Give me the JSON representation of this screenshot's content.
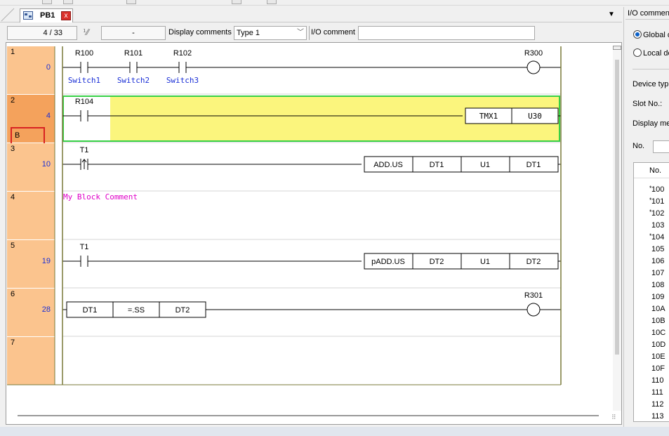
{
  "tab": {
    "label": "PB1",
    "close_glyph": "x",
    "icon": "program-block-icon"
  },
  "tab_menu_arrow": "▼",
  "info_bar": {
    "position": "4 /    33",
    "step": "-",
    "display_comments_label": "Display comments",
    "comment_type": "Type 1",
    "io_comment_label": "I/O comment",
    "io_comment_value": ""
  },
  "ladder": {
    "rows": [
      {
        "line": "1",
        "step": "0",
        "marker": "",
        "contacts": [
          {
            "device": "R100",
            "comment": "Switch1",
            "type": "no"
          },
          {
            "device": "R101",
            "comment": "Switch2",
            "type": "no"
          },
          {
            "device": "R102",
            "comment": "Switch3",
            "type": "no"
          }
        ],
        "output": {
          "kind": "coil",
          "device": "R300"
        }
      },
      {
        "line": "2",
        "step": "4",
        "marker": "B",
        "contacts": [
          {
            "device": "R104",
            "comment": "",
            "type": "no"
          }
        ],
        "output": {
          "kind": "instruction",
          "operands": [
            "TMX1",
            "U30"
          ]
        }
      },
      {
        "line": "3",
        "step": "10",
        "marker": "",
        "contacts": [
          {
            "device": "T1",
            "comment": "",
            "type": "rising"
          }
        ],
        "output": {
          "kind": "instruction",
          "operands": [
            "ADD.US",
            "DT1",
            "U1",
            "DT1"
          ]
        }
      },
      {
        "line": "4",
        "step": "",
        "marker": "",
        "block_comment": "My Block Comment"
      },
      {
        "line": "5",
        "step": "19",
        "marker": "",
        "contacts": [
          {
            "device": "T1",
            "comment": "",
            "type": "no"
          }
        ],
        "output": {
          "kind": "instruction",
          "operands": [
            "pADD.US",
            "DT2",
            "U1",
            "DT2"
          ]
        }
      },
      {
        "line": "6",
        "step": "28",
        "marker": "",
        "compare": [
          "DT1",
          "=.SS",
          "DT2"
        ],
        "output": {
          "kind": "coil",
          "device": "R301"
        }
      },
      {
        "line": "7",
        "step": "",
        "marker": ""
      }
    ]
  },
  "panel": {
    "title": "I/O comment",
    "radio_global": "Global d",
    "radio_local": "Local de",
    "device_type_label": "Device typ",
    "slot_label": "Slot No.:",
    "display_mem_label": "Display me",
    "no_label": "No.",
    "table_header": "No.",
    "table_rows": [
      {
        "mark": "*",
        "no": "100"
      },
      {
        "mark": "*",
        "no": "101"
      },
      {
        "mark": "*",
        "no": "102"
      },
      {
        "mark": "",
        "no": "103"
      },
      {
        "mark": "*",
        "no": "104"
      },
      {
        "mark": "",
        "no": "105"
      },
      {
        "mark": "",
        "no": "106"
      },
      {
        "mark": "",
        "no": "107"
      },
      {
        "mark": "",
        "no": "108"
      },
      {
        "mark": "",
        "no": "109"
      },
      {
        "mark": "",
        "no": "10A"
      },
      {
        "mark": "",
        "no": "10B"
      },
      {
        "mark": "",
        "no": "10C"
      },
      {
        "mark": "",
        "no": "10D"
      },
      {
        "mark": "",
        "no": "10E"
      },
      {
        "mark": "",
        "no": "10F"
      },
      {
        "mark": "",
        "no": "110"
      },
      {
        "mark": "",
        "no": "111"
      },
      {
        "mark": "",
        "no": "112"
      },
      {
        "mark": "",
        "no": "113"
      }
    ]
  },
  "colors": {
    "gutter": "#fbc48e",
    "gutter_active": "#f4a25c",
    "step_text": "#1a2fd6",
    "comment_text": "#1a2fd6",
    "block_comment_text": "#e000c8",
    "selection_fill": "#fbf57d",
    "selection_border": "#36d046",
    "marker_border": "#d82222"
  }
}
